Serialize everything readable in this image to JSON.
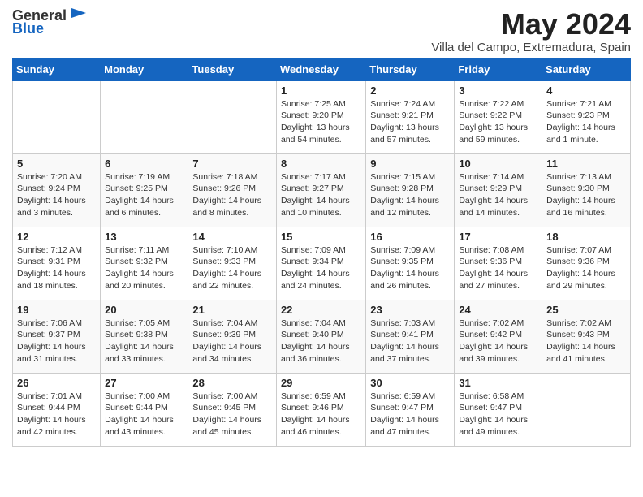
{
  "header": {
    "logo_general": "General",
    "logo_blue": "Blue",
    "month_title": "May 2024",
    "location": "Villa del Campo, Extremadura, Spain"
  },
  "days_of_week": [
    "Sunday",
    "Monday",
    "Tuesday",
    "Wednesday",
    "Thursday",
    "Friday",
    "Saturday"
  ],
  "weeks": [
    [
      {
        "day": "",
        "info": ""
      },
      {
        "day": "",
        "info": ""
      },
      {
        "day": "",
        "info": ""
      },
      {
        "day": "1",
        "info": "Sunrise: 7:25 AM\nSunset: 9:20 PM\nDaylight: 13 hours and 54 minutes."
      },
      {
        "day": "2",
        "info": "Sunrise: 7:24 AM\nSunset: 9:21 PM\nDaylight: 13 hours and 57 minutes."
      },
      {
        "day": "3",
        "info": "Sunrise: 7:22 AM\nSunset: 9:22 PM\nDaylight: 13 hours and 59 minutes."
      },
      {
        "day": "4",
        "info": "Sunrise: 7:21 AM\nSunset: 9:23 PM\nDaylight: 14 hours and 1 minute."
      }
    ],
    [
      {
        "day": "5",
        "info": "Sunrise: 7:20 AM\nSunset: 9:24 PM\nDaylight: 14 hours and 3 minutes."
      },
      {
        "day": "6",
        "info": "Sunrise: 7:19 AM\nSunset: 9:25 PM\nDaylight: 14 hours and 6 minutes."
      },
      {
        "day": "7",
        "info": "Sunrise: 7:18 AM\nSunset: 9:26 PM\nDaylight: 14 hours and 8 minutes."
      },
      {
        "day": "8",
        "info": "Sunrise: 7:17 AM\nSunset: 9:27 PM\nDaylight: 14 hours and 10 minutes."
      },
      {
        "day": "9",
        "info": "Sunrise: 7:15 AM\nSunset: 9:28 PM\nDaylight: 14 hours and 12 minutes."
      },
      {
        "day": "10",
        "info": "Sunrise: 7:14 AM\nSunset: 9:29 PM\nDaylight: 14 hours and 14 minutes."
      },
      {
        "day": "11",
        "info": "Sunrise: 7:13 AM\nSunset: 9:30 PM\nDaylight: 14 hours and 16 minutes."
      }
    ],
    [
      {
        "day": "12",
        "info": "Sunrise: 7:12 AM\nSunset: 9:31 PM\nDaylight: 14 hours and 18 minutes."
      },
      {
        "day": "13",
        "info": "Sunrise: 7:11 AM\nSunset: 9:32 PM\nDaylight: 14 hours and 20 minutes."
      },
      {
        "day": "14",
        "info": "Sunrise: 7:10 AM\nSunset: 9:33 PM\nDaylight: 14 hours and 22 minutes."
      },
      {
        "day": "15",
        "info": "Sunrise: 7:09 AM\nSunset: 9:34 PM\nDaylight: 14 hours and 24 minutes."
      },
      {
        "day": "16",
        "info": "Sunrise: 7:09 AM\nSunset: 9:35 PM\nDaylight: 14 hours and 26 minutes."
      },
      {
        "day": "17",
        "info": "Sunrise: 7:08 AM\nSunset: 9:36 PM\nDaylight: 14 hours and 27 minutes."
      },
      {
        "day": "18",
        "info": "Sunrise: 7:07 AM\nSunset: 9:36 PM\nDaylight: 14 hours and 29 minutes."
      }
    ],
    [
      {
        "day": "19",
        "info": "Sunrise: 7:06 AM\nSunset: 9:37 PM\nDaylight: 14 hours and 31 minutes."
      },
      {
        "day": "20",
        "info": "Sunrise: 7:05 AM\nSunset: 9:38 PM\nDaylight: 14 hours and 33 minutes."
      },
      {
        "day": "21",
        "info": "Sunrise: 7:04 AM\nSunset: 9:39 PM\nDaylight: 14 hours and 34 minutes."
      },
      {
        "day": "22",
        "info": "Sunrise: 7:04 AM\nSunset: 9:40 PM\nDaylight: 14 hours and 36 minutes."
      },
      {
        "day": "23",
        "info": "Sunrise: 7:03 AM\nSunset: 9:41 PM\nDaylight: 14 hours and 37 minutes."
      },
      {
        "day": "24",
        "info": "Sunrise: 7:02 AM\nSunset: 9:42 PM\nDaylight: 14 hours and 39 minutes."
      },
      {
        "day": "25",
        "info": "Sunrise: 7:02 AM\nSunset: 9:43 PM\nDaylight: 14 hours and 41 minutes."
      }
    ],
    [
      {
        "day": "26",
        "info": "Sunrise: 7:01 AM\nSunset: 9:44 PM\nDaylight: 14 hours and 42 minutes."
      },
      {
        "day": "27",
        "info": "Sunrise: 7:00 AM\nSunset: 9:44 PM\nDaylight: 14 hours and 43 minutes."
      },
      {
        "day": "28",
        "info": "Sunrise: 7:00 AM\nSunset: 9:45 PM\nDaylight: 14 hours and 45 minutes."
      },
      {
        "day": "29",
        "info": "Sunrise: 6:59 AM\nSunset: 9:46 PM\nDaylight: 14 hours and 46 minutes."
      },
      {
        "day": "30",
        "info": "Sunrise: 6:59 AM\nSunset: 9:47 PM\nDaylight: 14 hours and 47 minutes."
      },
      {
        "day": "31",
        "info": "Sunrise: 6:58 AM\nSunset: 9:47 PM\nDaylight: 14 hours and 49 minutes."
      },
      {
        "day": "",
        "info": ""
      }
    ]
  ]
}
